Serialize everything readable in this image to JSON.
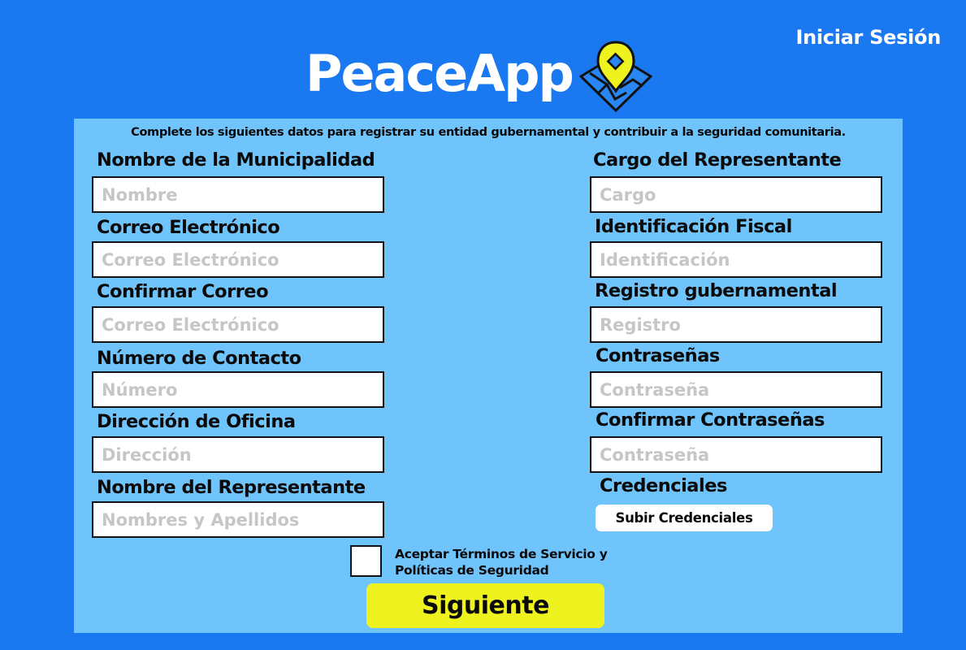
{
  "header": {
    "login_link": "Iniciar Sesión",
    "brand": "PeaceApp",
    "logo_icon": "map-pin-icon"
  },
  "form": {
    "intro": "Complete los siguientes datos para registrar su entidad gubernamental y contribuir a la seguridad comunitaria.",
    "municipality": {
      "label": "Nombre de la Municipalidad",
      "placeholder": "Nombre"
    },
    "email": {
      "label": "Correo Electrónico",
      "placeholder": "Correo Electrónico"
    },
    "confirm_email": {
      "label": "Confirmar Correo",
      "placeholder": "Correo Electrónico"
    },
    "phone": {
      "label": "Número de Contacto",
      "placeholder": "Número"
    },
    "address": {
      "label": "Dirección de Oficina",
      "placeholder": "Dirección"
    },
    "representative": {
      "label": "Nombre del Representante",
      "placeholder": "Nombres y Apellidos"
    },
    "position": {
      "label": "Cargo del Representante",
      "placeholder": "Cargo"
    },
    "tax_id": {
      "label": "Identificación Fiscal",
      "placeholder": "Identificación"
    },
    "gov_registry": {
      "label": "Registro gubernamental",
      "placeholder": "Registro"
    },
    "password": {
      "label": "Contraseñas",
      "placeholder": "Contraseña"
    },
    "confirm_password": {
      "label": "Confirmar Contraseñas",
      "placeholder": "Contraseña"
    },
    "credentials": {
      "label": "Credenciales",
      "button": "Subir Credenciales"
    },
    "terms": "Aceptar Términos de Servicio y Políticas de Seguridad",
    "submit": "Siguiente"
  },
  "colors": {
    "background": "#1a78f0",
    "panel": "#70c4fc",
    "primary_button": "#eef21e",
    "logo_pin": "#eef21e"
  }
}
